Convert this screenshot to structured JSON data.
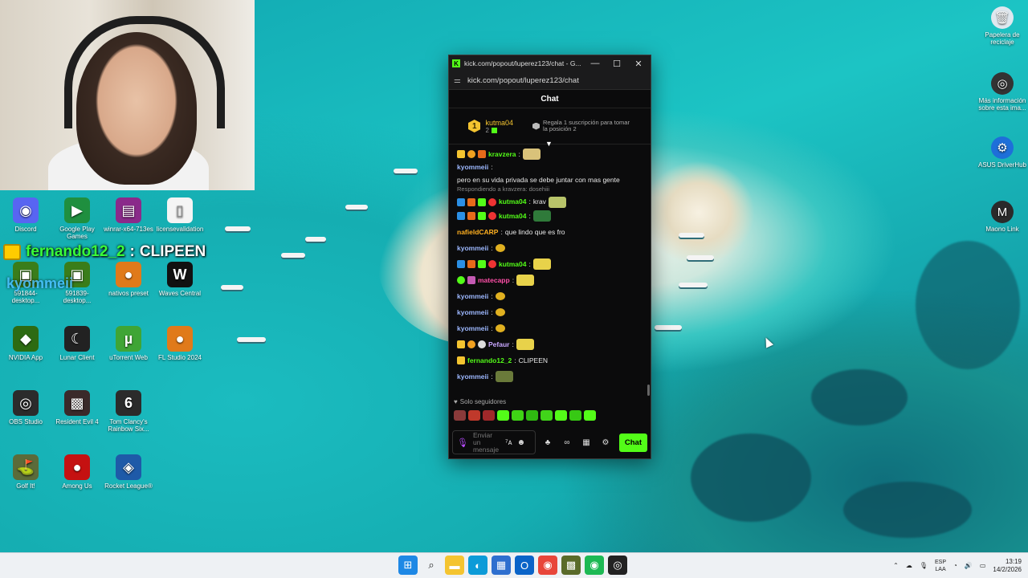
{
  "webcam": {},
  "overlay": {
    "username": "fernando12_2",
    "separator": ":",
    "message": "CLIPEEN",
    "sub_name": "kyommeii"
  },
  "desktop_left": [
    {
      "label": "Discord",
      "icon": "discord-icon",
      "color": "#5865f2",
      "glyph": "◉"
    },
    {
      "label": "Google Play Games",
      "icon": "google-play-games-icon",
      "color": "#1f8f3f",
      "glyph": "▶"
    },
    {
      "label": "winrar-x64-713es",
      "icon": "winrar-icon",
      "color": "#8a2a8a",
      "glyph": "▤"
    },
    {
      "label": "licensevalidation",
      "icon": "document-icon",
      "color": "#f4f4f4",
      "glyph": "▯"
    },
    {
      "label": "591844-desktop...",
      "icon": "nvidia-icon",
      "color": "#3a7d1a",
      "glyph": "▣"
    },
    {
      "label": "591839-desktop...",
      "icon": "nvidia-icon",
      "color": "#3a7d1a",
      "glyph": "▣"
    },
    {
      "label": "nativos preset",
      "icon": "fl-studio-icon",
      "color": "#e07a1a",
      "glyph": "●"
    },
    {
      "label": "Waves Central",
      "icon": "waves-icon",
      "color": "#111111",
      "glyph": "W"
    },
    {
      "label": "NVIDIA App",
      "icon": "nvidia-app-icon",
      "color": "#2d6b12",
      "glyph": "◆"
    },
    {
      "label": "Lunar Client",
      "icon": "lunar-client-icon",
      "color": "#222222",
      "glyph": "☾"
    },
    {
      "label": "uTorrent Web",
      "icon": "utorrent-icon",
      "color": "#3fa535",
      "glyph": "µ"
    },
    {
      "label": "FL Studio 2024",
      "icon": "fl-studio-icon",
      "color": "#e07a1a",
      "glyph": "●"
    },
    {
      "label": "OBS Studio",
      "icon": "obs-icon",
      "color": "#2b2b2b",
      "glyph": "◎"
    },
    {
      "label": "Resident Evil 4",
      "icon": "resident-evil-icon",
      "color": "#3a2a2a",
      "glyph": "▩"
    },
    {
      "label": "Tom Clancy's Rainbow Six...",
      "icon": "rainbow-six-icon",
      "color": "#2b2b2b",
      "glyph": "6"
    },
    {
      "label": "Golf It!",
      "icon": "golf-it-icon",
      "color": "#5b6b3a",
      "glyph": "⛳"
    },
    {
      "label": "Among Us",
      "icon": "among-us-icon",
      "color": "#c51111",
      "glyph": "●"
    },
    {
      "label": "Rocket League®",
      "icon": "rocket-league-icon",
      "color": "#1e5aa8",
      "glyph": "◈"
    }
  ],
  "desktop_right": [
    {
      "label": "Papelera de reciclaje",
      "icon": "recycle-bin-icon",
      "glyph": "🗑",
      "color": "#dfe8ef"
    },
    {
      "label": "Más información sobre esta ima...",
      "icon": "camera-info-icon",
      "glyph": "◎",
      "color": "#333333"
    },
    {
      "label": "ASUS DriverHub",
      "icon": "asus-driverhub-icon",
      "glyph": "⚙",
      "color": "#1e6fd9"
    },
    {
      "label": "Maono Link",
      "icon": "maono-link-icon",
      "glyph": "M",
      "color": "#2a2a2a"
    }
  ],
  "popup": {
    "tab_title": "kick.com/popout/luperez123/chat - G...",
    "minimize": "—",
    "maximize": "☐",
    "close": "✕",
    "url": "kick.com/popout/luperez123/chat",
    "chat_title": "Chat",
    "pinned": {
      "rank": "1",
      "username": "kutma04",
      "count": "2",
      "cta": "Regala 1 suscripción para tomar la posición 2"
    },
    "followers_only": "Solo seguidores",
    "input_placeholder": "Enviar un mensaje",
    "chat_button": "Chat"
  },
  "messages": [
    {
      "user": "kravzera",
      "color": "#53fc18",
      "text": "",
      "sep": ":"
    },
    {
      "user": "kyommeii",
      "color": "#9db8ff",
      "text": "pero en su vida privada se debe juntar con mas gente",
      "sep": ":"
    },
    {
      "reply": "Respondiendo a kravzera: dosehiii",
      "user": "kutma04",
      "color": "#53fc18",
      "text": "krav",
      "sep": ":"
    },
    {
      "user": "kutma04",
      "color": "#53fc18",
      "text": "",
      "sep": ":"
    },
    {
      "user": "nafieldCARP",
      "color": "#ffb020",
      "text": "que lindo que es fro",
      "sep": ":"
    },
    {
      "user": "kyommeii",
      "color": "#9db8ff",
      "text": "",
      "sep": ":"
    },
    {
      "user": "kutma04",
      "color": "#53fc18",
      "text": "",
      "sep": ":"
    },
    {
      "user": "matecapp",
      "color": "#ff4fa8",
      "text": "",
      "sep": ":"
    },
    {
      "user": "kyommeii",
      "color": "#9db8ff",
      "text": "",
      "sep": ":"
    },
    {
      "user": "kyommeii",
      "color": "#9db8ff",
      "text": "",
      "sep": ":"
    },
    {
      "user": "kyommeii",
      "color": "#9db8ff",
      "text": "",
      "sep": ":"
    },
    {
      "user": "Pefaur",
      "color": "#c9a7ff",
      "text": "",
      "sep": ":"
    },
    {
      "user": "fernando12_2",
      "color": "#53fc18",
      "text": "CLIPEEN",
      "sep": ":"
    },
    {
      "user": "kyommeii",
      "color": "#9db8ff",
      "text": "",
      "sep": ":"
    }
  ],
  "taskbar": {
    "apps": [
      "windows-start-icon",
      "search-icon",
      "file-explorer-icon",
      "edge-icon",
      "store-icon",
      "outlook-icon",
      "chrome-icon",
      "minecraft-icon",
      "spotify-icon",
      "obs-taskbar-icon"
    ],
    "lang_top": "ESP",
    "lang_bottom": "LAA",
    "time": "13:19",
    "date": "14/2/2026"
  }
}
